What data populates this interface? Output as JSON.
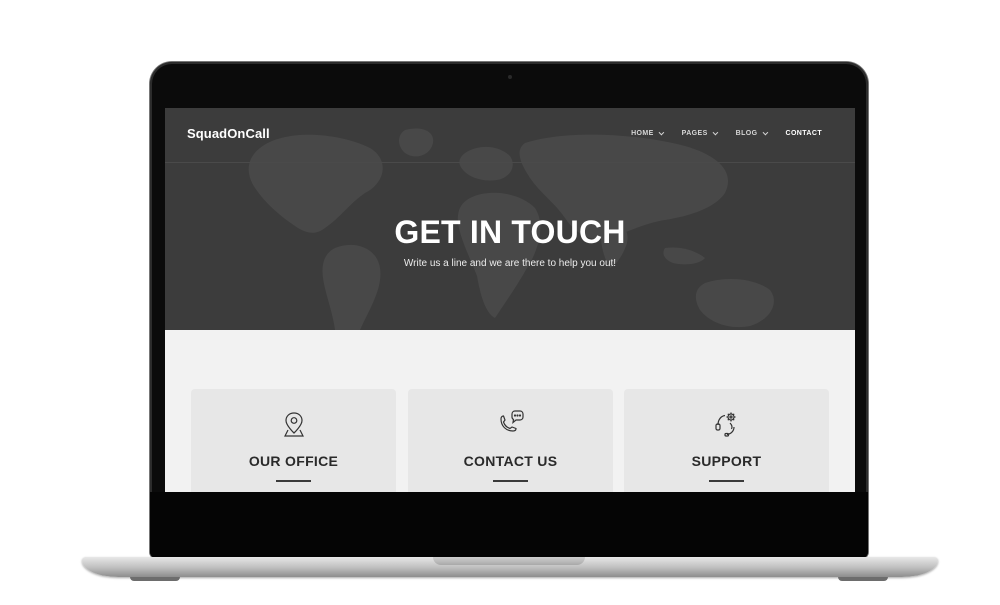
{
  "site": {
    "brand": "SquadOnCall"
  },
  "nav": {
    "items": [
      {
        "label": "HOME",
        "has_dropdown": true
      },
      {
        "label": "PAGES",
        "has_dropdown": true
      },
      {
        "label": "BLOG",
        "has_dropdown": true
      },
      {
        "label": "CONTACT",
        "has_dropdown": false,
        "active": true
      }
    ]
  },
  "hero": {
    "title": "GET IN TOUCH",
    "subtitle": "Write us a line and we are there to help you out!"
  },
  "cards": [
    {
      "title": "OUR OFFICE",
      "icon": "map-pin-icon"
    },
    {
      "title": "CONTACT US",
      "icon": "phone-chat-icon"
    },
    {
      "title": "SUPPORT",
      "icon": "headset-gear-icon"
    }
  ],
  "colors": {
    "hero_bg": "#3c3c3c",
    "section_bg": "#f2f2f2",
    "card_bg": "#e7e7e7",
    "text_dark": "#2a2a2a"
  }
}
